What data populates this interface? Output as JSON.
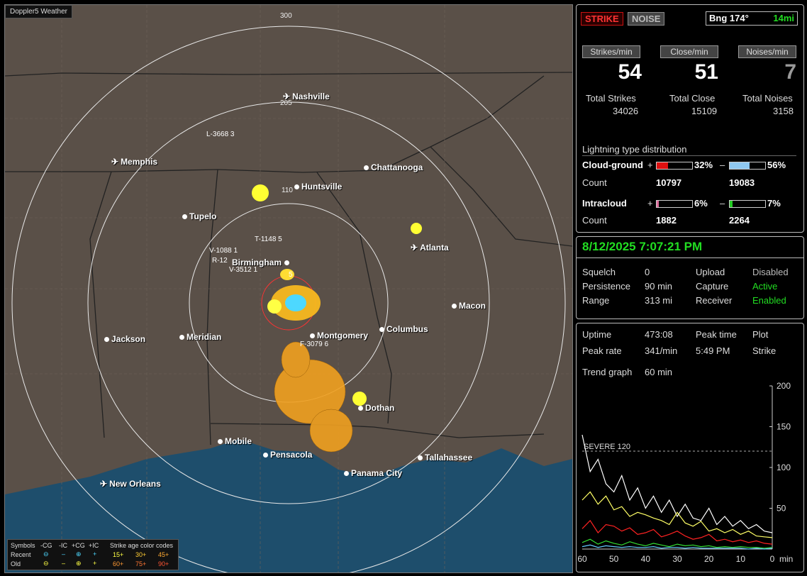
{
  "app_title": "Doppler5 Weather",
  "map": {
    "range_labels": [
      "300",
      "205",
      "110"
    ],
    "cities": [
      {
        "name": "Nashville",
        "type": "airport"
      },
      {
        "name": "Memphis",
        "type": "airport"
      },
      {
        "name": "Chattanooga",
        "type": "city"
      },
      {
        "name": "Huntsville",
        "type": "city"
      },
      {
        "name": "Tupelo",
        "type": "city"
      },
      {
        "name": "Atlanta",
        "type": "airport"
      },
      {
        "name": "Birmingham",
        "type": "city"
      },
      {
        "name": "Macon",
        "type": "city"
      },
      {
        "name": "Jackson",
        "type": "city"
      },
      {
        "name": "Meridian",
        "type": "city"
      },
      {
        "name": "Montgomery",
        "type": "city"
      },
      {
        "name": "Columbus",
        "type": "city"
      },
      {
        "name": "Dothan",
        "type": "city"
      },
      {
        "name": "Mobile",
        "type": "city"
      },
      {
        "name": "Pensacola",
        "type": "city"
      },
      {
        "name": "Tallahassee",
        "type": "city"
      },
      {
        "name": "Panama City",
        "type": "city"
      },
      {
        "name": "New Orleans",
        "type": "airport"
      }
    ],
    "strike_labels": [
      "L-3668 3",
      "T-1148 5",
      "V-1088 1",
      "R-12",
      "V-3512 1",
      "5",
      "F-3079 6"
    ],
    "legend": {
      "symbols_label": "Symbols",
      "headers": [
        "-CG",
        "-IC",
        "+CG",
        "+IC"
      ],
      "age_title": "Strike age color codes",
      "recent_label": "Recent",
      "old_label": "Old",
      "recent_ages": [
        "15+",
        "30+",
        "45+"
      ],
      "old_ages": [
        "60+",
        "75+",
        "90+"
      ]
    }
  },
  "panel_top": {
    "strike_btn": "STRIKE",
    "noise_btn": "NOISE",
    "bearing": "Bng 174°",
    "distance": "14mi",
    "rate_headers": [
      "Strikes/min",
      "Close/min",
      "Noises/min"
    ],
    "rates": [
      "54",
      "51",
      "7"
    ],
    "total_labels": [
      "Total Strikes",
      "Total Close",
      "Total Noises"
    ],
    "totals": [
      "34026",
      "15109",
      "3158"
    ],
    "dist_title": "Lightning type distribution",
    "cg_label": "Cloud-ground",
    "ic_label": "Intracloud",
    "count_label": "Count",
    "plus": "+",
    "minus": "–",
    "cg_pos_pct": "32%",
    "cg_neg_pct": "56%",
    "ic_pos_pct": "6%",
    "ic_neg_pct": "7%",
    "cg_pos_count": "10797",
    "cg_neg_count": "19083",
    "ic_pos_count": "1882",
    "ic_neg_count": "2264",
    "bars": {
      "cg_pos": 0.32,
      "cg_neg": 0.56,
      "ic_pos": 0.06,
      "ic_neg": 0.07
    }
  },
  "panel_mid": {
    "datetime": "8/12/2025 7:07:21 PM",
    "squelch_label": "Squelch",
    "squelch": "0",
    "persistence_label": "Persistence",
    "persistence": "90 min",
    "range_label": "Range",
    "range": "313 mi",
    "upload_label": "Upload",
    "upload": "Disabled",
    "capture_label": "Capture",
    "capture": "Active",
    "receiver_label": "Receiver",
    "receiver": "Enabled"
  },
  "panel_bottom": {
    "uptime_label": "Uptime",
    "uptime": "473:08",
    "peak_time_label": "Peak time",
    "peak_time": "5:49 PM",
    "plot_label": "Plot",
    "plot": "Strike",
    "peak_rate_label": "Peak rate",
    "peak_rate": "341/min",
    "trend_label": "Trend graph",
    "trend": "60 min",
    "severe_label": "SEVERE 120",
    "y_ticks": [
      "200",
      "150",
      "100",
      "50"
    ],
    "x_ticks": [
      "60",
      "50",
      "40",
      "30",
      "20",
      "10",
      "0"
    ],
    "x_unit": "min"
  },
  "colors": {
    "accent_green": "#22dd22",
    "strike_red": "#cc1111",
    "cg_pos_bar": "#dd1111",
    "cg_neg_bar": "#8fc8f0",
    "ic_pos_bar": "#e070a0",
    "ic_neg_bar": "#22cc22"
  },
  "chart_data": {
    "type": "line",
    "title": "",
    "xlabel": "min",
    "ylabel": "",
    "xlim": [
      60,
      0
    ],
    "ylim": [
      0,
      200
    ],
    "reference_line": {
      "label": "SEVERE 120",
      "value": 120
    },
    "series": [
      {
        "color": "#ffffff",
        "values": [
          140,
          95,
          110,
          80,
          70,
          90,
          60,
          75,
          50,
          65,
          45,
          60,
          40,
          55,
          38,
          35,
          50,
          30,
          40,
          28,
          35,
          25,
          30,
          22,
          20
        ]
      },
      {
        "color": "#ffff66",
        "values": [
          60,
          70,
          55,
          65,
          48,
          52,
          40,
          45,
          42,
          38,
          35,
          30,
          45,
          32,
          28,
          34,
          22,
          25,
          20,
          24,
          18,
          22,
          16,
          15,
          14
        ]
      },
      {
        "color": "#ff2222",
        "values": [
          25,
          35,
          20,
          30,
          28,
          22,
          26,
          18,
          20,
          24,
          15,
          18,
          22,
          16,
          12,
          14,
          18,
          10,
          12,
          9,
          11,
          8,
          10,
          7,
          6
        ]
      },
      {
        "color": "#33dd33",
        "values": [
          8,
          12,
          6,
          10,
          7,
          5,
          9,
          6,
          4,
          7,
          5,
          3,
          6,
          4,
          5,
          3,
          4,
          2,
          3,
          2,
          3,
          2,
          2,
          1,
          2
        ]
      },
      {
        "color": "#66ccff",
        "values": [
          3,
          5,
          2,
          4,
          3,
          2,
          3,
          2,
          2,
          3,
          1,
          2,
          2,
          1,
          2,
          1,
          1,
          1,
          1,
          1,
          1,
          0,
          1,
          0,
          1
        ]
      }
    ]
  }
}
